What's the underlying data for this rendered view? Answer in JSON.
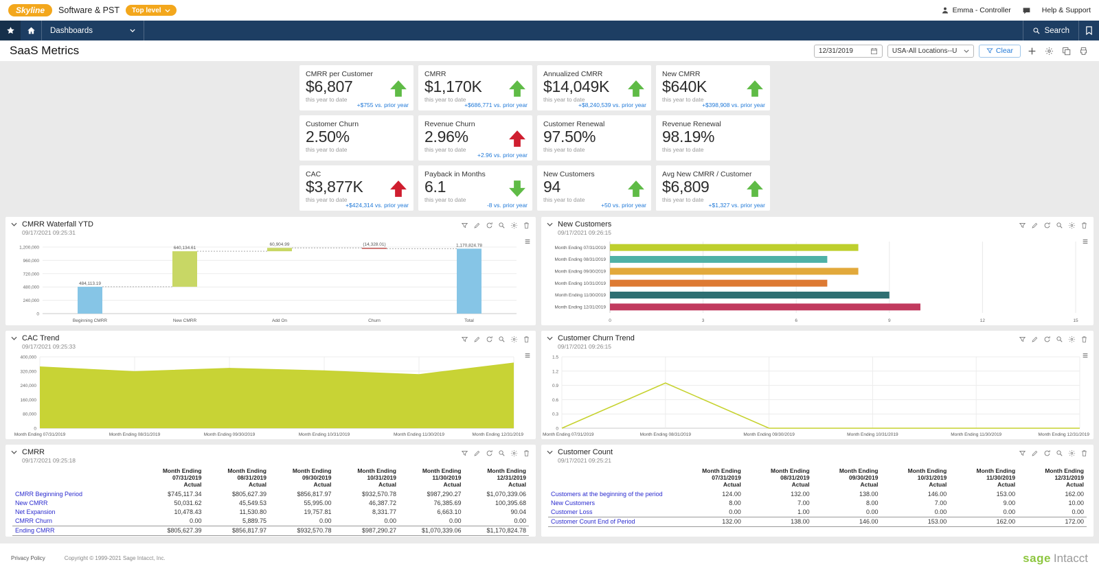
{
  "colors": {
    "navy": "#1d3e63",
    "orange": "#f3a71c",
    "green": "#5fbb46",
    "red": "#cf1e2f",
    "footnote_blue": "#2079d8",
    "link_blue": "#2a2ace",
    "chart_green": "#c6d22e",
    "bg_gray": "#eaeaea",
    "sage_green": "#8dc63f"
  },
  "topbar": {
    "logo": "Skyline",
    "company": "Software & PST",
    "entity_pill": "Top level",
    "user": "Emma - Controller",
    "help": "Help & Support"
  },
  "nav": {
    "menu": "Dashboards",
    "search": "Search"
  },
  "header": {
    "title": "SaaS Metrics",
    "date_value": "12/31/2019",
    "location_value": "USA-All Locations--U",
    "clear_label": "Clear"
  },
  "kpis": [
    {
      "title": "CMRR per Customer",
      "value": "$6,807",
      "period": "this year to date",
      "arrow": "up-green",
      "footnote": "+$755 vs. prior year"
    },
    {
      "title": "CMRR",
      "value": "$1,170K",
      "period": "this year to date",
      "arrow": "up-green",
      "footnote": "+$686,771 vs. prior year"
    },
    {
      "title": "Annualized CMRR",
      "value": "$14,049K",
      "period": "this year to date",
      "arrow": "up-green",
      "footnote": "+$8,240,539 vs. prior year"
    },
    {
      "title": "New CMRR",
      "value": "$640K",
      "period": "this year to date",
      "arrow": "up-green",
      "footnote": "+$398,908 vs. prior year"
    },
    {
      "title": "Customer Churn",
      "value": "2.50%",
      "period": "this year to date",
      "arrow": "none",
      "footnote": ""
    },
    {
      "title": "Revenue Churn",
      "value": "2.96%",
      "period": "this year to date",
      "arrow": "up-red",
      "footnote": "+2.96 vs. prior year"
    },
    {
      "title": "Customer Renewal",
      "value": "97.50%",
      "period": "this year to date",
      "arrow": "none",
      "footnote": ""
    },
    {
      "title": "Revenue Renewal",
      "value": "98.19%",
      "period": "this year to date",
      "arrow": "none",
      "footnote": ""
    },
    {
      "title": "CAC",
      "value": "$3,877K",
      "period": "this year to date",
      "arrow": "up-red",
      "footnote": "+$424,314 vs. prior year"
    },
    {
      "title": "Payback in Months",
      "value": "6.1",
      "period": "this year to date",
      "arrow": "down-green",
      "footnote": "-8 vs. prior year"
    },
    {
      "title": "New Customers",
      "value": "94",
      "period": "this year to date",
      "arrow": "up-green",
      "footnote": "+50 vs. prior year"
    },
    {
      "title": "Avg New CMRR / Customer",
      "value": "$6,809",
      "period": "this year to date",
      "arrow": "up-green",
      "footnote": "+$1,327 vs. prior year"
    }
  ],
  "panel_tools": [
    "filter",
    "edit",
    "refresh",
    "zoom",
    "settings",
    "delete"
  ],
  "panels": {
    "waterfall": {
      "title": "CMRR Waterfall YTD",
      "timestamp": "09/17/2021 09:25:31"
    },
    "new_customers": {
      "title": "New Customers",
      "timestamp": "09/17/2021 09:26:15"
    },
    "cac_trend": {
      "title": "CAC Trend",
      "timestamp": "09/17/2021 09:25:33"
    },
    "churn_trend": {
      "title": "Customer Churn Trend",
      "timestamp": "09/17/2021 09:26:15"
    },
    "cmrr": {
      "title": "CMRR",
      "timestamp": "09/17/2021 09:25:18"
    },
    "customer_count": {
      "title": "Customer Count",
      "timestamp": "09/17/2021 09:25:21"
    }
  },
  "chart_data": [
    {
      "id": "cmrr_waterfall",
      "type": "bar",
      "subtype": "waterfall",
      "title": "CMRR Waterfall YTD",
      "categories": [
        "Beginning CMRR",
        "New CMRR",
        "Add On",
        "Churn",
        "Total"
      ],
      "values": [
        484113.19,
        640134.61,
        60904.99,
        -14328.01,
        1170824.78
      ],
      "value_labels": [
        "484,113.19",
        "640,134.61",
        "60,904.99",
        "(14,328.01)",
        "1,170,824.78"
      ],
      "ylim": [
        0,
        1200000
      ],
      "yticks": [
        0,
        240000,
        480000,
        720000,
        960000,
        1200000
      ],
      "ytick_labels": [
        "0",
        "240,000",
        "480,000",
        "720,000",
        "960,000",
        "1,200,000"
      ],
      "bar_colors": [
        "#86c5e6",
        "#c8d765",
        "#c8d765",
        "#c0504d",
        "#86c5e6"
      ]
    },
    {
      "id": "new_customers",
      "type": "bar",
      "orientation": "horizontal",
      "title": "New Customers",
      "categories": [
        "Month Ending 07/31/2019",
        "Month Ending 08/31/2019",
        "Month Ending 09/30/2019",
        "Month Ending 10/31/2019",
        "Month Ending 11/30/2019",
        "Month Ending 12/31/2019"
      ],
      "values": [
        8,
        7,
        8,
        7,
        9,
        10
      ],
      "xlim": [
        0,
        15
      ],
      "xticks": [
        0,
        3,
        6,
        9,
        12,
        15
      ],
      "bar_colors": [
        "#becf2d",
        "#4fb1a6",
        "#e2a93b",
        "#dd7a33",
        "#2f6f72",
        "#c13a5e"
      ]
    },
    {
      "id": "cac_trend",
      "type": "area",
      "title": "CAC Trend",
      "x": [
        "Month Ending 07/31/2019",
        "Month Ending 08/31/2019",
        "Month Ending 09/30/2019",
        "Month Ending 10/31/2019",
        "Month Ending 11/30/2019",
        "Month Ending 12/31/2019"
      ],
      "values": [
        344000,
        318000,
        336000,
        322000,
        301000,
        366000
      ],
      "ylim": [
        0,
        400000
      ],
      "yticks": [
        0,
        80000,
        160000,
        240000,
        320000,
        400000
      ],
      "ytick_labels": [
        "0",
        "80,000",
        "160,000",
        "240,000",
        "320,000",
        "400,000"
      ],
      "color": "#c6d22e"
    },
    {
      "id": "customer_churn_trend",
      "type": "line",
      "title": "Customer Churn Trend",
      "x": [
        "Month Ending 07/31/2019",
        "Month Ending 08/31/2019",
        "Month Ending 09/30/2019",
        "Month Ending 10/31/2019",
        "Month Ending 11/30/2019",
        "Month Ending 12/31/2019"
      ],
      "values": [
        0,
        0.95,
        0,
        0,
        0,
        0
      ],
      "ylim": [
        0,
        1.5
      ],
      "yticks": [
        0,
        0.3,
        0.6,
        0.9,
        1.2,
        1.5
      ],
      "ytick_labels": [
        "0",
        "0.3",
        "0.6",
        "0.9",
        "1.2",
        "1.5"
      ],
      "color": "#c6d22e"
    },
    {
      "id": "cmrr_table",
      "type": "table",
      "title": "CMRR",
      "columns": [
        {
          "line1": "Month Ending",
          "line2": "07/31/2019",
          "line3": "Actual"
        },
        {
          "line1": "Month Ending",
          "line2": "08/31/2019",
          "line3": "Actual"
        },
        {
          "line1": "Month Ending",
          "line2": "09/30/2019",
          "line3": "Actual"
        },
        {
          "line1": "Month Ending",
          "line2": "10/31/2019",
          "line3": "Actual"
        },
        {
          "line1": "Month Ending",
          "line2": "11/30/2019",
          "line3": "Actual"
        },
        {
          "line1": "Month Ending",
          "line2": "12/31/2019",
          "line3": "Actual"
        }
      ],
      "rows": [
        {
          "label": "CMRR Beginning Period",
          "values": [
            "$745,117.34",
            "$805,627.39",
            "$856,817.97",
            "$932,570.78",
            "$987,290.27",
            "$1,070,339.06"
          ]
        },
        {
          "label": "New CMRR",
          "values": [
            "50,031.62",
            "45,549.53",
            "55,995.00",
            "46,387.72",
            "76,385.69",
            "100,395.68"
          ]
        },
        {
          "label": "Net Expansion",
          "values": [
            "10,478.43",
            "11,530.80",
            "19,757.81",
            "8,331.77",
            "6,663.10",
            "90.04"
          ]
        },
        {
          "label": "CMRR Churn",
          "values": [
            "0.00",
            "5,889.75",
            "0.00",
            "0.00",
            "0.00",
            "0.00"
          ]
        },
        {
          "label": "Ending CMRR",
          "values": [
            "$805,627.39",
            "$856,817.97",
            "$932,570.78",
            "$987,290.27",
            "$1,070,339.06",
            "$1,170,824.78"
          ],
          "total": true
        }
      ]
    },
    {
      "id": "customer_count_table",
      "type": "table",
      "title": "Customer Count",
      "columns": [
        {
          "line1": "Month Ending",
          "line2": "07/31/2019",
          "line3": "Actual"
        },
        {
          "line1": "Month Ending",
          "line2": "08/31/2019",
          "line3": "Actual"
        },
        {
          "line1": "Month Ending",
          "line2": "09/30/2019",
          "line3": "Actual"
        },
        {
          "line1": "Month Ending",
          "line2": "10/31/2019",
          "line3": "Actual"
        },
        {
          "line1": "Month Ending",
          "line2": "11/30/2019",
          "line3": "Actual"
        },
        {
          "line1": "Month Ending",
          "line2": "12/31/2019",
          "line3": "Actual"
        }
      ],
      "rows": [
        {
          "label": "Customers at the beginning of the period",
          "values": [
            "124.00",
            "132.00",
            "138.00",
            "146.00",
            "153.00",
            "162.00"
          ]
        },
        {
          "label": "New Customers",
          "values": [
            "8.00",
            "7.00",
            "8.00",
            "7.00",
            "9.00",
            "10.00"
          ]
        },
        {
          "label": "Customer Loss",
          "values": [
            "0.00",
            "1.00",
            "0.00",
            "0.00",
            "0.00",
            "0.00"
          ]
        },
        {
          "label": "Customer Count End of Period",
          "values": [
            "132.00",
            "138.00",
            "146.00",
            "153.00",
            "162.00",
            "172.00"
          ],
          "total": true
        }
      ]
    }
  ],
  "footer": {
    "privacy": "Privacy Policy",
    "copyright": "Copyright © 1999-2021 Sage Intacct, Inc.",
    "logo_sage": "sage",
    "logo_intacct": "Intacct"
  }
}
